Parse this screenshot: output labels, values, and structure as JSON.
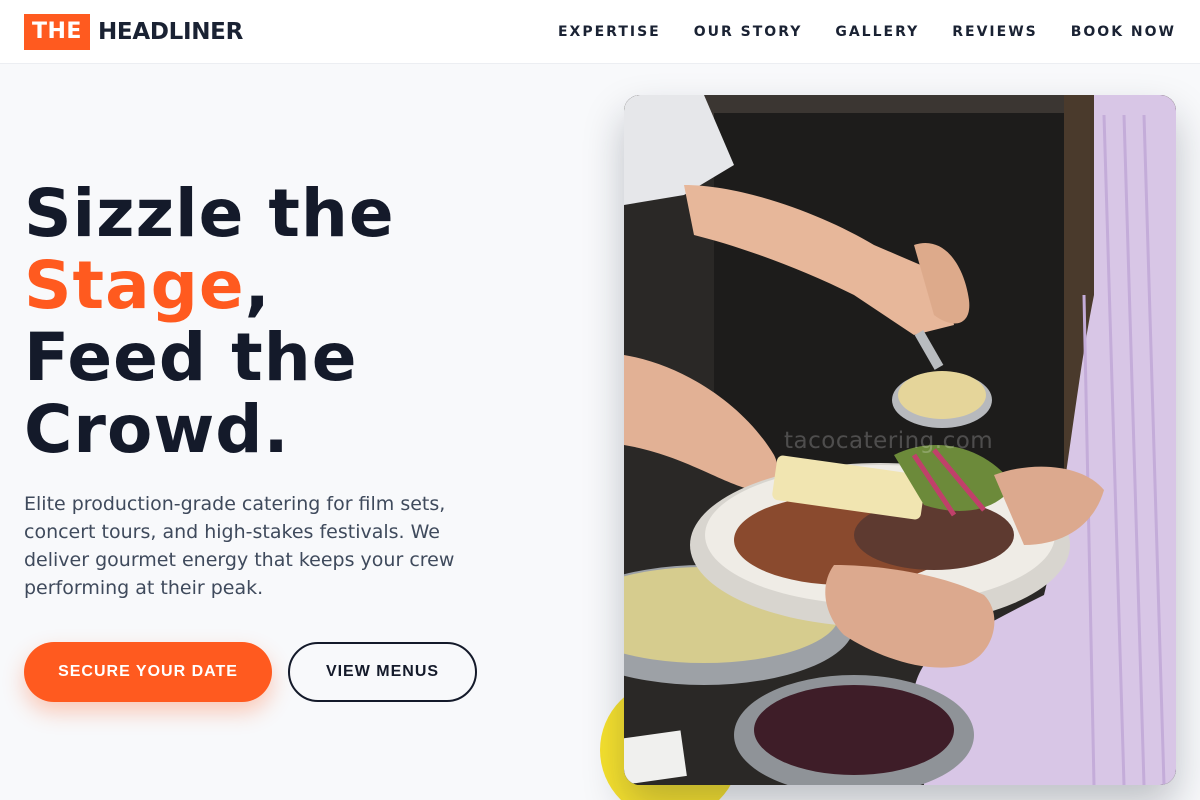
{
  "brand": {
    "badge": "THE",
    "name": "HEADLINER",
    "accent_color": "#ff5a1f"
  },
  "nav": {
    "items": [
      {
        "label": "EXPERTISE"
      },
      {
        "label": "OUR STORY"
      },
      {
        "label": "GALLERY"
      },
      {
        "label": "REVIEWS"
      },
      {
        "label": "BOOK NOW"
      }
    ]
  },
  "hero": {
    "title_line1": "Sizzle the",
    "title_accent": "Stage",
    "title_comma": ",",
    "title_line3": "Feed the",
    "title_line4": "Crowd.",
    "description": "Elite production-grade catering for film sets, concert tours, and high-stakes festivals. We deliver gourmet energy that keeps your crew performing at their peak.",
    "primary_cta": "SECURE YOUR DATE",
    "secondary_cta": "VIEW MENUS"
  },
  "photo": {
    "watermark": "tacocatering.com"
  }
}
